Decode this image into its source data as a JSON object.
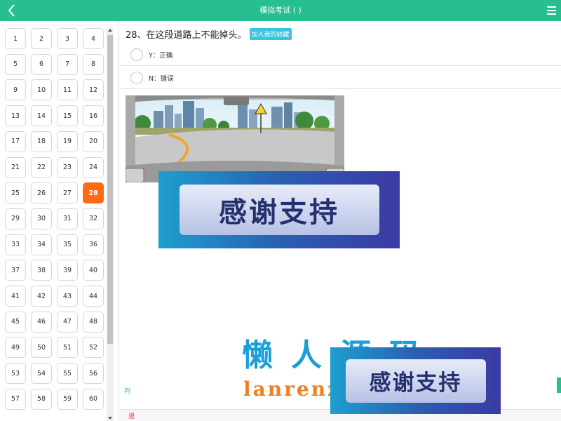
{
  "header": {
    "title": "模拟考试 ( )",
    "back_icon": "chevron-left-icon",
    "menu_icon": "hamburger-menu-icon",
    "color": "#27bf91"
  },
  "sidebar": {
    "numbers": [
      "1",
      "2",
      "3",
      "4",
      "5",
      "6",
      "7",
      "8",
      "9",
      "10",
      "11",
      "12",
      "13",
      "14",
      "15",
      "16",
      "17",
      "18",
      "19",
      "20",
      "21",
      "22",
      "23",
      "24",
      "25",
      "26",
      "27",
      "28",
      "29",
      "30",
      "31",
      "32",
      "33",
      "34",
      "35",
      "36",
      "37",
      "38",
      "39",
      "40",
      "41",
      "42",
      "43",
      "44",
      "45",
      "46",
      "47",
      "48",
      "49",
      "50",
      "51",
      "52",
      "53",
      "54",
      "55",
      "56",
      "57",
      "58",
      "59",
      "60"
    ],
    "active": "28",
    "active_color": "#ff6a13"
  },
  "question": {
    "text": "28、在这段道路上不能掉头。",
    "favorite_label": "加入我的收藏",
    "options": [
      {
        "key": "Y",
        "label": "Y：正确"
      },
      {
        "key": "N",
        "label": "N：错误"
      }
    ]
  },
  "overlays": {
    "thanks_text": "感谢支持",
    "watermark_cn": "懒人源码",
    "watermark_en": "lanrenzhijia"
  },
  "fragments": {
    "left_green": "判",
    "left_red": "退"
  }
}
